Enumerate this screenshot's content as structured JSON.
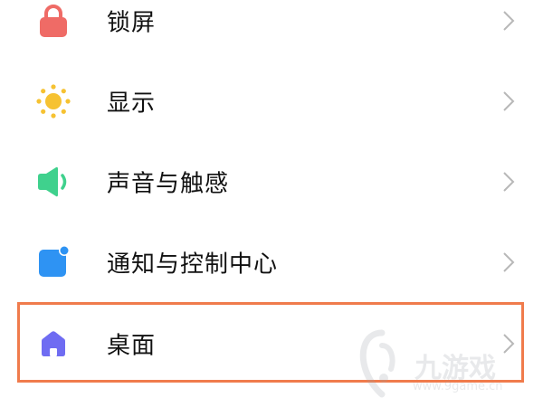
{
  "settings": {
    "items": [
      {
        "label": "锁屏",
        "icon": "lock-icon",
        "icon_color": "#ef6b66"
      },
      {
        "label": "显示",
        "icon": "sun-icon",
        "icon_color": "#f6c232"
      },
      {
        "label": "声音与触感",
        "icon": "speaker-icon",
        "icon_color": "#3fd18d"
      },
      {
        "label": "通知与控制中心",
        "icon": "notification-icon",
        "icon_color": "#2e93f3"
      },
      {
        "label": "桌面",
        "icon": "home-icon",
        "icon_color": "#6f6cf2"
      }
    ],
    "highlighted_item": "桌面",
    "highlight_color": "#f07b4c"
  },
  "watermark": {
    "text": "九游戏",
    "url": "www.9game.cn"
  }
}
